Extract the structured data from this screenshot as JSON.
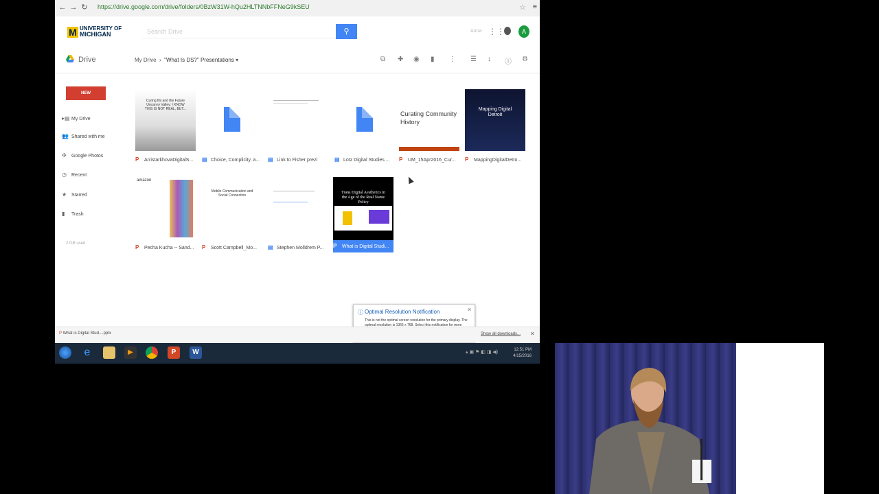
{
  "browser": {
    "url": "https://drive.google.com/drive/folders/0BzW31W-hQu2HLTNNbFFNeG9kSEU"
  },
  "header": {
    "logo_text_line1": "UNIVERSITY OF",
    "logo_text_line2": "MICHIGAN",
    "search_placeholder": "Search Drive",
    "aside_text": "Anna"
  },
  "drive": {
    "name": "Drive",
    "breadcrumb_root": "My Drive",
    "breadcrumb_sep": "›",
    "breadcrumb_current": "\"What Is DS?\" Presentations"
  },
  "sidebar": {
    "new_label": "NEW",
    "items": [
      {
        "label": "My Drive",
        "icon": "folder-icon"
      },
      {
        "label": "Shared with me",
        "icon": "people-icon"
      },
      {
        "label": "Google Photos",
        "icon": "pinwheel-icon"
      },
      {
        "label": "Recent",
        "icon": "clock-icon"
      },
      {
        "label": "Starred",
        "icon": "star-icon"
      },
      {
        "label": "Trash",
        "icon": "trash-icon"
      }
    ],
    "storage": "2 GB used"
  },
  "files": [
    {
      "name": "ArristarkhovaDigitalS...",
      "type": "ppt",
      "thumb_title": "Curing Ills and the Future Uncanny Valley: I KNOW THIS IS NOT REAL, BUT..."
    },
    {
      "name": "Choice, Complicity, a...",
      "type": "doc",
      "thumb_title": ""
    },
    {
      "name": "Link to Fisher prezi",
      "type": "doc",
      "thumb_title": ""
    },
    {
      "name": "Lotz Digital Studies ...",
      "type": "doc",
      "thumb_title": ""
    },
    {
      "name": "UM_15Apr2016_Cur...",
      "type": "ppt",
      "thumb_title": "Curating Community History"
    },
    {
      "name": "MappingDigitalDetro...",
      "type": "ppt",
      "thumb_title": "Mapping Digital Detroit"
    },
    {
      "name": "Pecha Kucha -- Sand...",
      "type": "ppt",
      "thumb_title": "amazon"
    },
    {
      "name": "Scott Campbell_Mo...",
      "type": "ppt",
      "thumb_title": "Mobile Communication and Social Connection"
    },
    {
      "name": "Stephen Molldrem P...",
      "type": "doc",
      "thumb_title": ""
    },
    {
      "name": "What is Digital Studi...",
      "type": "ppt",
      "thumb_title": "Trans Digital Aesthetics in the Age of the Real Name Policy"
    }
  ],
  "notification": {
    "title": "Optimal Resolution Notification",
    "body": "This is not the optimal screen resolution for the primary display. The optimal resolution is 1366 x 768. Select this notification for more information."
  },
  "downloads": {
    "item": "What is Digital Stud....pptx",
    "show_all": "Show all downloads..."
  },
  "taskbar": {
    "time": "12:51 PM",
    "date": "4/15/2016"
  }
}
